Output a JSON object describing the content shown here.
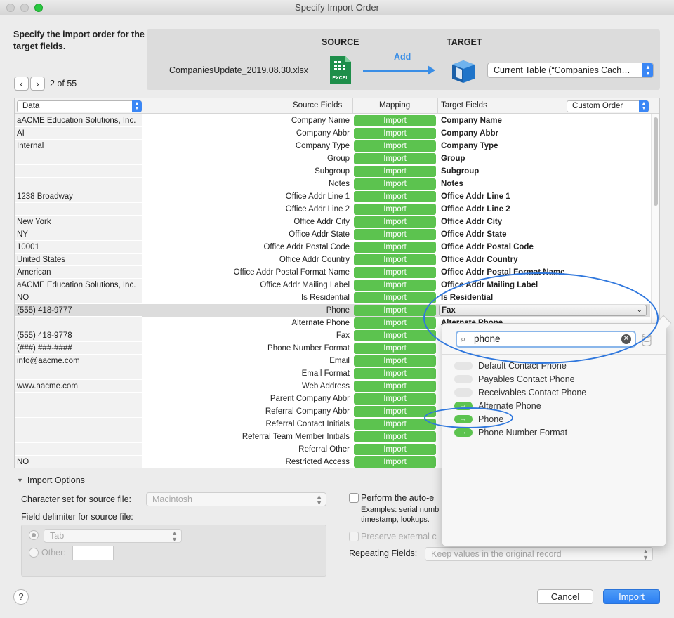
{
  "window": {
    "title": "Specify Import Order"
  },
  "header": {
    "instruction": "Specify the import order for the target fields.",
    "record_position": "2 of 55",
    "prev_icon": "chevron-left-icon",
    "next_icon": "chevron-right-icon"
  },
  "banner": {
    "source_label": "SOURCE",
    "target_label": "TARGET",
    "add_label": "Add",
    "source_file": "CompaniesUpdate_2019.08.30.xlsx",
    "excel_badge": "EXCEL",
    "target_table": "Current Table (“Companies|Cach…",
    "accent_color": "#3a8ee6"
  },
  "grid": {
    "data_select": "Data",
    "col_source": "Source Fields",
    "col_mapping": "Mapping",
    "col_target": "Target Fields",
    "order_select": "Custom Order",
    "rows": [
      {
        "data": "aACME Education Solutions, Inc.",
        "source": "Company Name",
        "map": "Import",
        "target": "Company Name"
      },
      {
        "data": "AI",
        "source": "Company Abbr",
        "map": "Import",
        "target": "Company Abbr"
      },
      {
        "data": "Internal",
        "source": "Company Type",
        "map": "Import",
        "target": "Company Type"
      },
      {
        "data": "",
        "source": "Group",
        "map": "Import",
        "target": "Group"
      },
      {
        "data": "",
        "source": "Subgroup",
        "map": "Import",
        "target": "Subgroup"
      },
      {
        "data": "",
        "source": "Notes",
        "map": "Import",
        "target": "Notes"
      },
      {
        "data": "1238 Broadway",
        "source": "Office Addr Line 1",
        "map": "Import",
        "target": "Office Addr Line 1"
      },
      {
        "data": "",
        "source": "Office Addr Line 2",
        "map": "Import",
        "target": "Office Addr Line 2"
      },
      {
        "data": "New York",
        "source": "Office Addr City",
        "map": "Import",
        "target": "Office Addr City"
      },
      {
        "data": "NY",
        "source": "Office Addr State",
        "map": "Import",
        "target": "Office Addr State"
      },
      {
        "data": "10001",
        "source": "Office Addr Postal Code",
        "map": "Import",
        "target": "Office Addr Postal Code"
      },
      {
        "data": "United States",
        "source": "Office Addr Country",
        "map": "Import",
        "target": "Office Addr Country"
      },
      {
        "data": "American",
        "source": "Office Addr Postal Format Name",
        "map": "Import",
        "target": "Office Addr Postal Format Name"
      },
      {
        "data": "aACME Education Solutions, Inc.",
        "source": "Office Addr Mailing Label",
        "map": "Import",
        "target": "Office Addr Mailing Label"
      },
      {
        "data": "NO",
        "source": "Is Residential",
        "map": "Import",
        "target": "Is Residential"
      },
      {
        "data": "(555) 418-9777",
        "source": "Phone",
        "map": "Import",
        "target": "Fax"
      },
      {
        "data": "",
        "source": "Alternate Phone",
        "map": "Import",
        "target": "Alternate Phone"
      },
      {
        "data": "(555) 418-9778",
        "source": "Fax",
        "map": "Import",
        "target": ""
      },
      {
        "data": "(###) ###-####",
        "source": "Phone Number Format",
        "map": "Import",
        "target": ""
      },
      {
        "data": "info@aacme.com",
        "source": "Email",
        "map": "Import",
        "target": ""
      },
      {
        "data": "",
        "source": "Email Format",
        "map": "Import",
        "target": ""
      },
      {
        "data": "www.aacme.com",
        "source": "Web Address",
        "map": "Import",
        "target": ""
      },
      {
        "data": "",
        "source": "Parent Company Abbr",
        "map": "Import",
        "target": ""
      },
      {
        "data": "",
        "source": "Referral Company Abbr",
        "map": "Import",
        "target": ""
      },
      {
        "data": "",
        "source": "Referral Contact Initials",
        "map": "Import",
        "target": ""
      },
      {
        "data": "",
        "source": "Referral Team Member Initials",
        "map": "Import",
        "target": ""
      },
      {
        "data": "",
        "source": "Referral Other",
        "map": "Import",
        "target": ""
      },
      {
        "data": "NO",
        "source": "Restricted Access",
        "map": "Import",
        "target": ""
      }
    ],
    "map_color": "#5cc34f"
  },
  "popover": {
    "search_value": "phone",
    "items": [
      {
        "label": "Default Contact Phone",
        "mapped": false
      },
      {
        "label": "Payables Contact Phone",
        "mapped": false
      },
      {
        "label": "Receivables Contact Phone",
        "mapped": false
      },
      {
        "label": "Alternate Phone",
        "mapped": true
      },
      {
        "label": "Phone",
        "mapped": true
      },
      {
        "label": "Phone Number Format",
        "mapped": true
      }
    ]
  },
  "options": {
    "toggle_label": "Import Options",
    "charset_label": "Character set for source file:",
    "charset_value": "Macintosh",
    "delimiter_label": "Field delimiter for source file:",
    "tab_value": "Tab",
    "other_label": "Other:",
    "auto_enter_label": "Perform the auto-e",
    "examples_line1": "Examples: serial numb",
    "examples_line2": "timestamp, lookups.",
    "preserve_label": "Preserve external c",
    "repeating_label": "Repeating Fields:",
    "repeating_value": "Keep values in the original record"
  },
  "footer": {
    "help": "?",
    "cancel": "Cancel",
    "import": "Import"
  }
}
